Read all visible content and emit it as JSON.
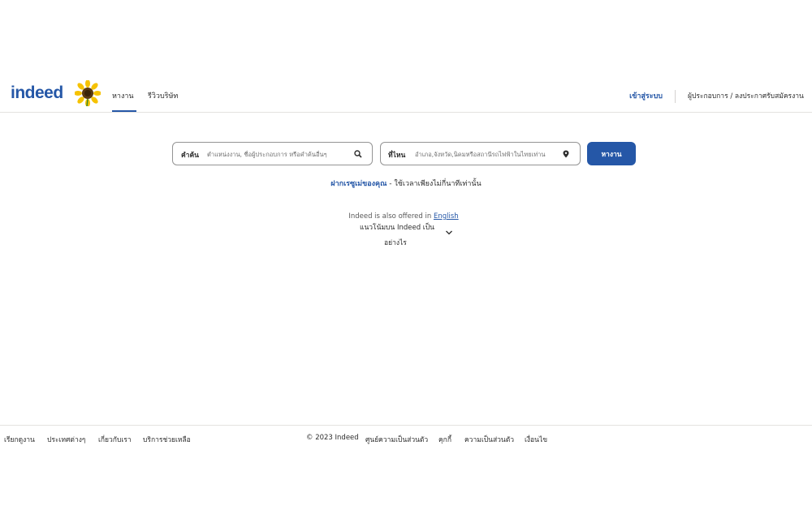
{
  "header": {
    "logo_text": "indeed",
    "tabs": [
      {
        "label": "หางาน"
      },
      {
        "label": "รีวิวบริษัท"
      }
    ],
    "signin_label": "เข้าสู่ระบบ",
    "employers_label": "ผู้ประกอบการ / ลงประกาศรับสมัครงาน",
    "icons": {
      "sunflower": "sunflower-logo-icon"
    }
  },
  "search": {
    "what_label": "คำค้น",
    "what_placeholder": "ตำแหน่งงาน, ชื่อผู้ประกอบการ หรือคำค้นอื่นๆ",
    "where_label": "ที่ไหน",
    "where_placeholder": "อำเภอ,จังหวัด,นิคมหรือสถานีรถไฟฟ้าในไทยเท่าน",
    "button_label": "หางาน",
    "icons": {
      "what": "search-icon",
      "where": "location-pin-icon"
    }
  },
  "resume": {
    "link_text": "ฝากเรซูเม่ของคุณ",
    "rest_text": " - ใช้เวลาเพียงไม่กี่นาทีเท่านั้น"
  },
  "language": {
    "prefix": "Indeed is also offered in ",
    "link": "English"
  },
  "feedback": {
    "line1": "แนวโน้มบน Indeed เป็น",
    "line2": "อย่างไร"
  },
  "footer": {
    "links": [
      "เรียกดูงาน",
      "ประเทศต่างๆ",
      "เกี่ยวกับเรา",
      "บริการช่วยเหลือ"
    ],
    "copyright": "© 2023 Indeed",
    "right_links": [
      "ศูนย์ความเป็นส่วนตัว",
      "คุกกี้",
      "ความเป็นส่วนตัว",
      "เงื่อนไข"
    ]
  },
  "colors": {
    "brand": "#2557a7",
    "text": "#2d2d2d",
    "border": "#949494"
  }
}
